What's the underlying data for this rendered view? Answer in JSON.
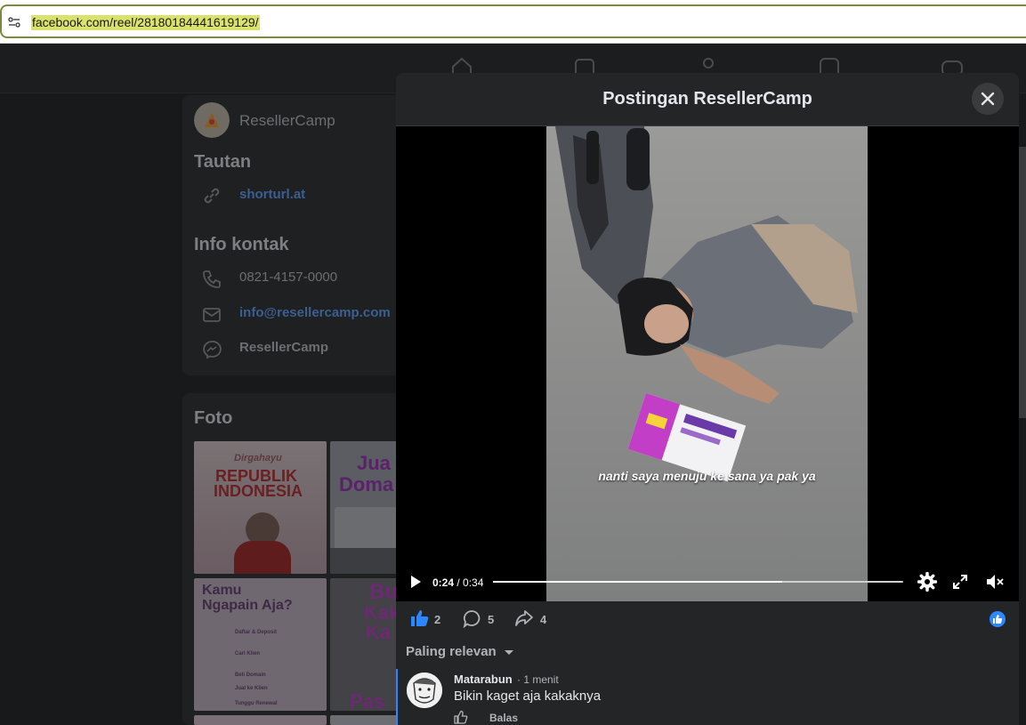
{
  "browser": {
    "url": "facebook.com/reel/28180184441619129/"
  },
  "page": {
    "name": "ResellerCamp",
    "links_title": "Tautan",
    "link_text": "shorturl.at",
    "contact_title": "Info kontak",
    "phone": "0821-4157-0000",
    "email": "info@resellercamp.com",
    "messenger": "ResellerCamp",
    "photos_title": "Foto"
  },
  "photos": {
    "tile1_line1": "Dirgahayu",
    "tile1_line2": "REPUBLIK",
    "tile1_line3": "INDONESIA",
    "tile2_line1": "Jua",
    "tile2_line2": "Doma",
    "tile3_line1": "Kamu",
    "tile3_line2": "Ngapain Aja?",
    "tile3_step1": "Daftar & Deposit",
    "tile3_step2": "Cari Klien",
    "tile3_step3": "Beli Domain",
    "tile3_step4": "Jual ke Klien",
    "tile3_step5": "Tunggu Renewal",
    "tile4_line1": "Bu",
    "tile4_line2": "Kak",
    "tile4_line3": "Ka",
    "tile4_line4": "Pas"
  },
  "modal": {
    "title": "Postingan ResellerCamp",
    "video_caption": "nanti saya menuju ke sana ya pak ya",
    "time_current": "0:24",
    "time_separator": " / ",
    "time_total": "0:34",
    "progress": 0.706,
    "likes": "2",
    "comments": "5",
    "shares": "4",
    "sort_label": "Paling relevan",
    "comment": {
      "author": "Matarabun",
      "time": "· 1 menit",
      "text": "Bikin kaget aja kakaknya",
      "reply_label": "Balas"
    }
  },
  "colors": {
    "accent": "#2d88ff",
    "link": "#3b5f93",
    "background": "#18191a"
  }
}
